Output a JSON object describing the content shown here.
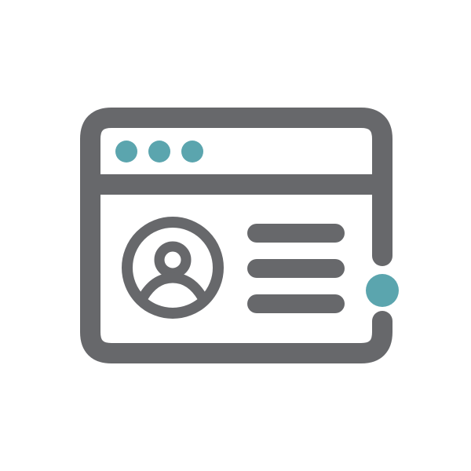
{
  "icon": {
    "name": "browser-user-profile-icon",
    "colors": {
      "background": "#ffffff",
      "stroke": "#67686b",
      "accent": "#5ba5ae"
    },
    "parts": {
      "window": "browser-window-icon",
      "dots": [
        "window-dot-icon",
        "window-dot-icon",
        "window-dot-icon"
      ],
      "avatar": "user-avatar-icon",
      "lines": [
        "text-line-icon",
        "text-line-icon",
        "text-line-icon"
      ],
      "status_dot": "status-dot-icon"
    }
  }
}
